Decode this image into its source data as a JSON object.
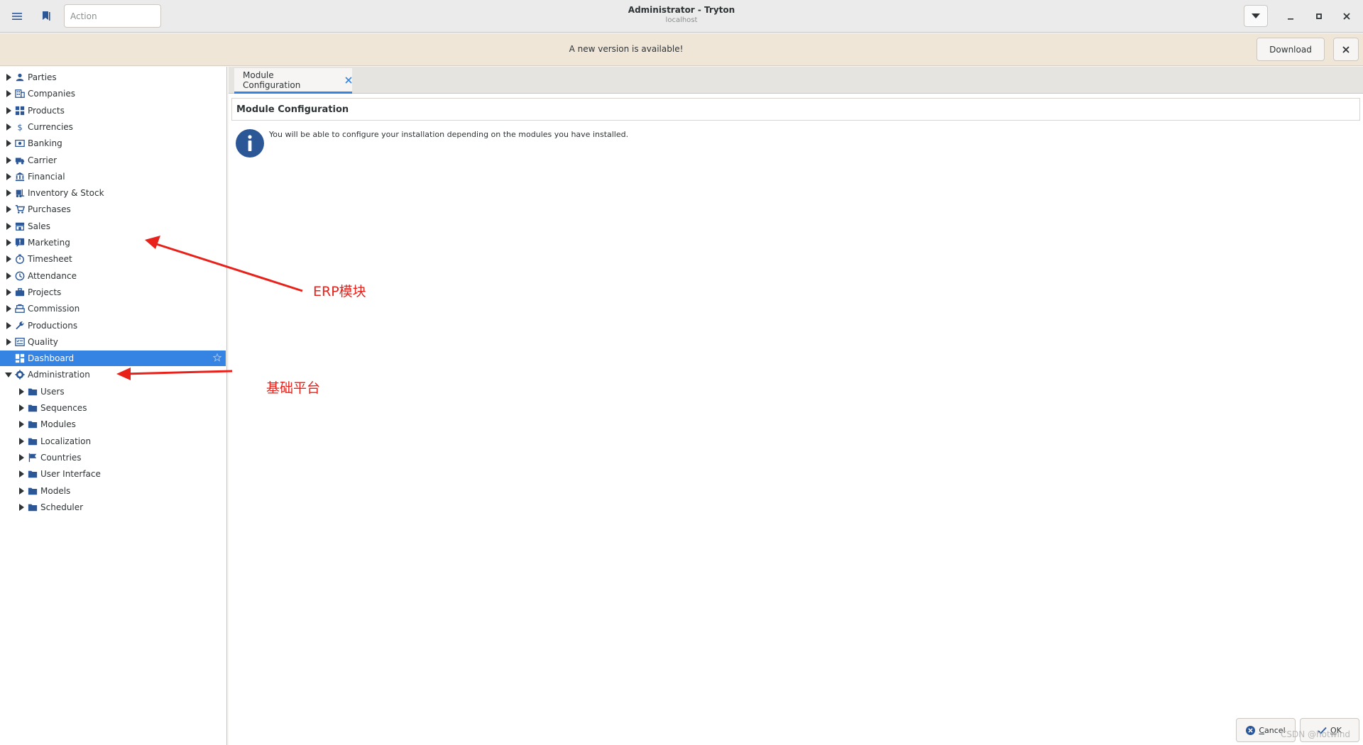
{
  "titlebar": {
    "action_placeholder": "Action",
    "title": "Administrator - Tryton",
    "subtitle": "localhost",
    "icons": {
      "menu": "hamburger-icon",
      "bookmark": "bookmark-icon",
      "dropdown": "caret-down-icon"
    }
  },
  "infobar": {
    "message": "A new version is available!",
    "download_label": "Download"
  },
  "sidebar": {
    "items": [
      {
        "label": "Parties",
        "icon": "user-icon",
        "level": 0,
        "expanded": false
      },
      {
        "label": "Companies",
        "icon": "building-icon",
        "level": 0,
        "expanded": false
      },
      {
        "label": "Products",
        "icon": "grid-icon",
        "level": 0,
        "expanded": false
      },
      {
        "label": "Currencies",
        "icon": "dollar-icon",
        "level": 0,
        "expanded": false
      },
      {
        "label": "Banking",
        "icon": "money-icon",
        "level": 0,
        "expanded": false
      },
      {
        "label": "Carrier",
        "icon": "truck-icon",
        "level": 0,
        "expanded": false
      },
      {
        "label": "Financial",
        "icon": "bank-icon",
        "level": 0,
        "expanded": false
      },
      {
        "label": "Inventory & Stock",
        "icon": "forklift-icon",
        "level": 0,
        "expanded": false
      },
      {
        "label": "Purchases",
        "icon": "cart-icon",
        "level": 0,
        "expanded": false
      },
      {
        "label": "Sales",
        "icon": "store-icon",
        "level": 0,
        "expanded": false
      },
      {
        "label": "Marketing",
        "icon": "announcement-icon",
        "level": 0,
        "expanded": false
      },
      {
        "label": "Timesheet",
        "icon": "stopwatch-icon",
        "level": 0,
        "expanded": false
      },
      {
        "label": "Attendance",
        "icon": "clock-icon",
        "level": 0,
        "expanded": false
      },
      {
        "label": "Projects",
        "icon": "briefcase-icon",
        "level": 0,
        "expanded": false
      },
      {
        "label": "Commission",
        "icon": "cashier-icon",
        "level": 0,
        "expanded": false
      },
      {
        "label": "Productions",
        "icon": "wrench-icon",
        "level": 0,
        "expanded": false
      },
      {
        "label": "Quality",
        "icon": "checklist-icon",
        "level": 0,
        "expanded": false
      },
      {
        "label": "Dashboard",
        "icon": "dashboard-icon",
        "level": 0,
        "expanded": null,
        "selected": true
      },
      {
        "label": "Administration",
        "icon": "gear-icon",
        "level": 0,
        "expanded": true
      },
      {
        "label": "Users",
        "icon": "folder-icon",
        "level": 1,
        "expanded": false
      },
      {
        "label": "Sequences",
        "icon": "folder-icon",
        "level": 1,
        "expanded": false
      },
      {
        "label": "Modules",
        "icon": "folder-icon",
        "level": 1,
        "expanded": false
      },
      {
        "label": "Localization",
        "icon": "folder-icon",
        "level": 1,
        "expanded": false
      },
      {
        "label": "Countries",
        "icon": "flag-icon",
        "level": 1,
        "expanded": false
      },
      {
        "label": "User Interface",
        "icon": "folder-icon",
        "level": 1,
        "expanded": false
      },
      {
        "label": "Models",
        "icon": "folder-icon",
        "level": 1,
        "expanded": false
      },
      {
        "label": "Scheduler",
        "icon": "folder-icon",
        "level": 1,
        "expanded": false
      }
    ]
  },
  "main": {
    "tab_label": "Module Configuration",
    "form_title": "Module Configuration",
    "info_text": "You will be able to configure your installation depending on the modules you have installed.",
    "cancel_label": "Cancel",
    "ok_label": "OK"
  },
  "annotations": {
    "erp": "ERP模块",
    "platform": "基础平台",
    "color": "#e8211a"
  },
  "watermark": "CSDN @hotwind",
  "colors": {
    "accent": "#3584e4",
    "infobar": "#f0e6d8",
    "icon_blue": "#2b5797"
  }
}
